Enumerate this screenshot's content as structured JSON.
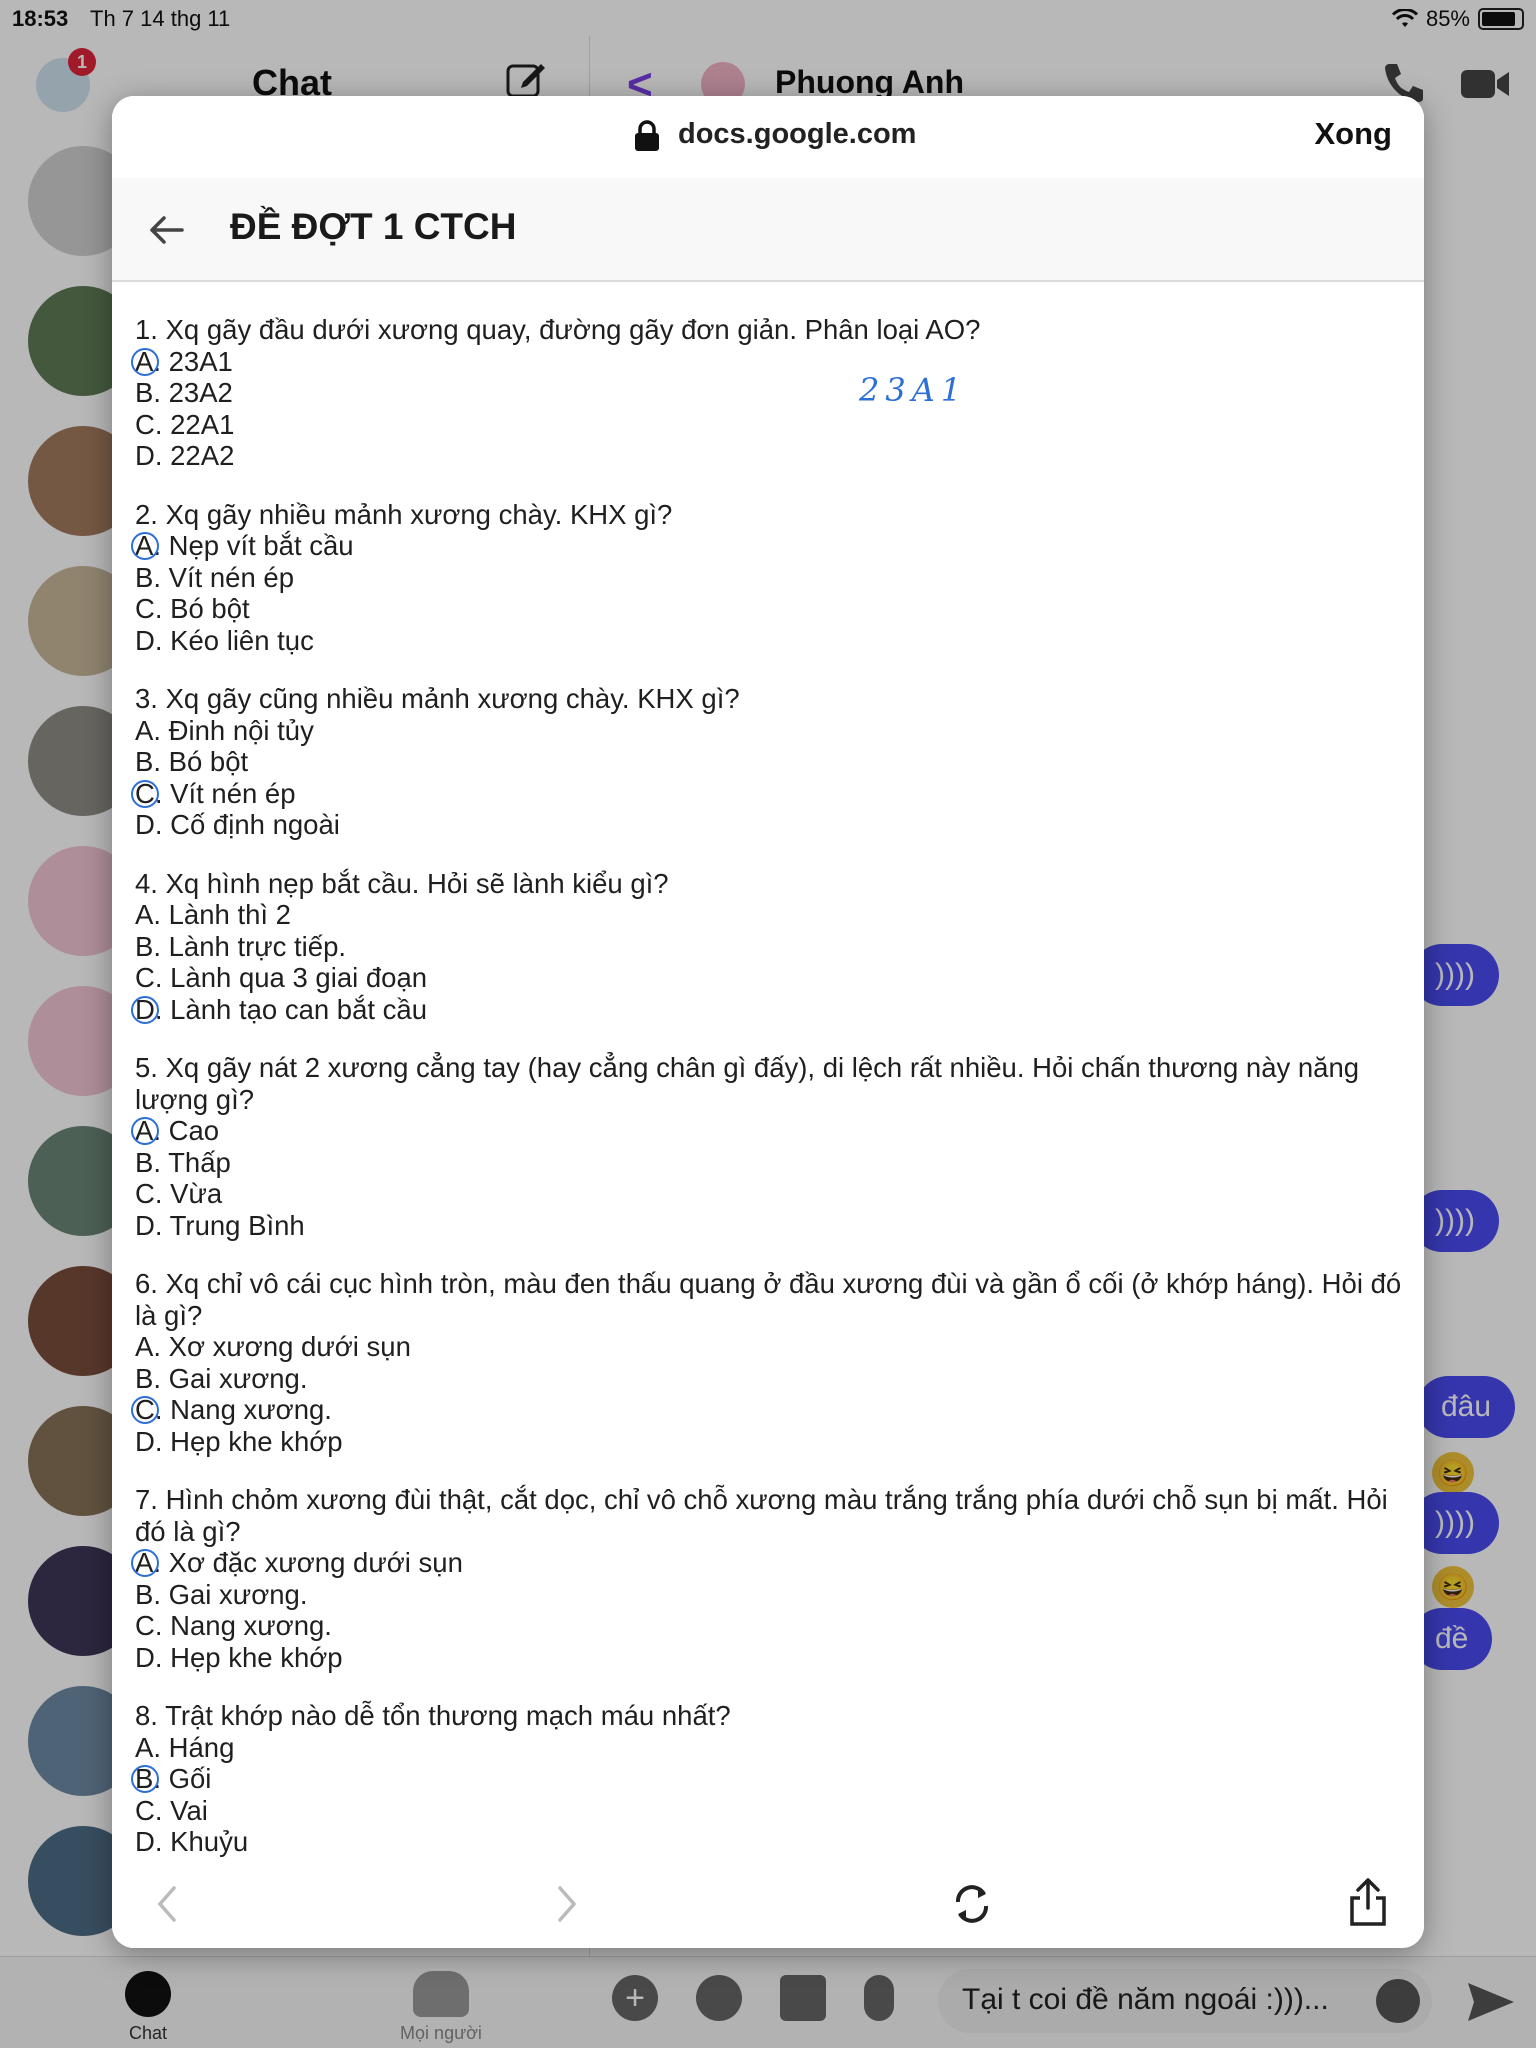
{
  "status_bar": {
    "time": "18:53",
    "date": "Th 7 14 thg 11",
    "battery": "85%"
  },
  "messenger": {
    "sidebar_title": "Chat",
    "notification_count": "1",
    "contact_name": "Phuong Anh",
    "bubbles": [
      "))))",
      "))))",
      "đâu",
      "))))",
      "đề"
    ],
    "reaction": "😆",
    "message_input": "Tại t coi đề năm ngoái :)))...",
    "tabs": {
      "chat": "Chat",
      "people": "Mọi người"
    },
    "accent_color": "#4a4cf0"
  },
  "browser": {
    "url": "docs.google.com",
    "done_label": "Xong",
    "doc_title": "ĐỀ ĐỢT 1 CTCH",
    "handwritten_note": "23A1"
  },
  "questions": [
    {
      "text": "1. Xq gãy đầu dưới xương quay, đường gãy đơn giản. Phân loại AO?",
      "options": [
        "A. 23A1",
        "B. 23A2",
        "C. 22A1",
        "D. 22A2"
      ],
      "marked": 0
    },
    {
      "text": "2. Xq gãy nhiều mảnh xương chày. KHX gì?",
      "options": [
        "A. Nẹp vít bắt cầu",
        "B. Vít nén ép",
        "C. Bó bột",
        "D. Kéo liên tục"
      ],
      "marked": 0
    },
    {
      "text": "3. Xq gãy cũng nhiều mảnh xương chày. KHX gì?",
      "options": [
        "A. Đinh nội tủy",
        "B. Bó bột",
        "C. Vít nén ép",
        "D. Cố định ngoài"
      ],
      "marked": 2
    },
    {
      "text": "4. Xq hình nẹp bắt cầu. Hỏi sẽ lành kiểu gì?",
      "options": [
        "A. Lành thì 2",
        "B. Lành trực tiếp.",
        "C. Lành qua 3 giai đoạn",
        "D. Lành tạo can bắt cầu"
      ],
      "marked": 3
    },
    {
      "text": "5. Xq gãy nát 2 xương cẳng tay (hay cẳng chân gì đấy), di lệch rất nhiều. Hỏi chấn thương này năng lượng gì?",
      "options": [
        "A. Cao",
        "B. Thấp",
        "C. Vừa",
        "D. Trung Bình"
      ],
      "marked": 0
    },
    {
      "text": "6. Xq chỉ vô cái cục hình tròn, màu đen thấu quang ở đầu xương đùi và gần ổ cối (ở khớp háng). Hỏi đó là gì?",
      "options": [
        "A. Xơ xương dưới sụn",
        "B. Gai xương.",
        "C. Nang xương.",
        "D. Hẹp khe khớp"
      ],
      "marked": 2
    },
    {
      "text": "7. Hình chỏm xương đùi thật, cắt dọc, chỉ vô chỗ xương màu trắng trắng phía dưới chỗ sụn bị mất. Hỏi đó là gì?",
      "options": [
        "A. Xơ đặc xương dưới sụn",
        "B. Gai xương.",
        "C. Nang xương.",
        "D. Hẹp khe khớp"
      ],
      "marked": 0
    },
    {
      "text": "8. Trật khớp nào dễ tổn thương mạch máu nhất?",
      "options": [
        "A. Háng",
        "B. Gối",
        "C. Vai",
        "D. Khuỷu"
      ],
      "marked": 1
    }
  ]
}
